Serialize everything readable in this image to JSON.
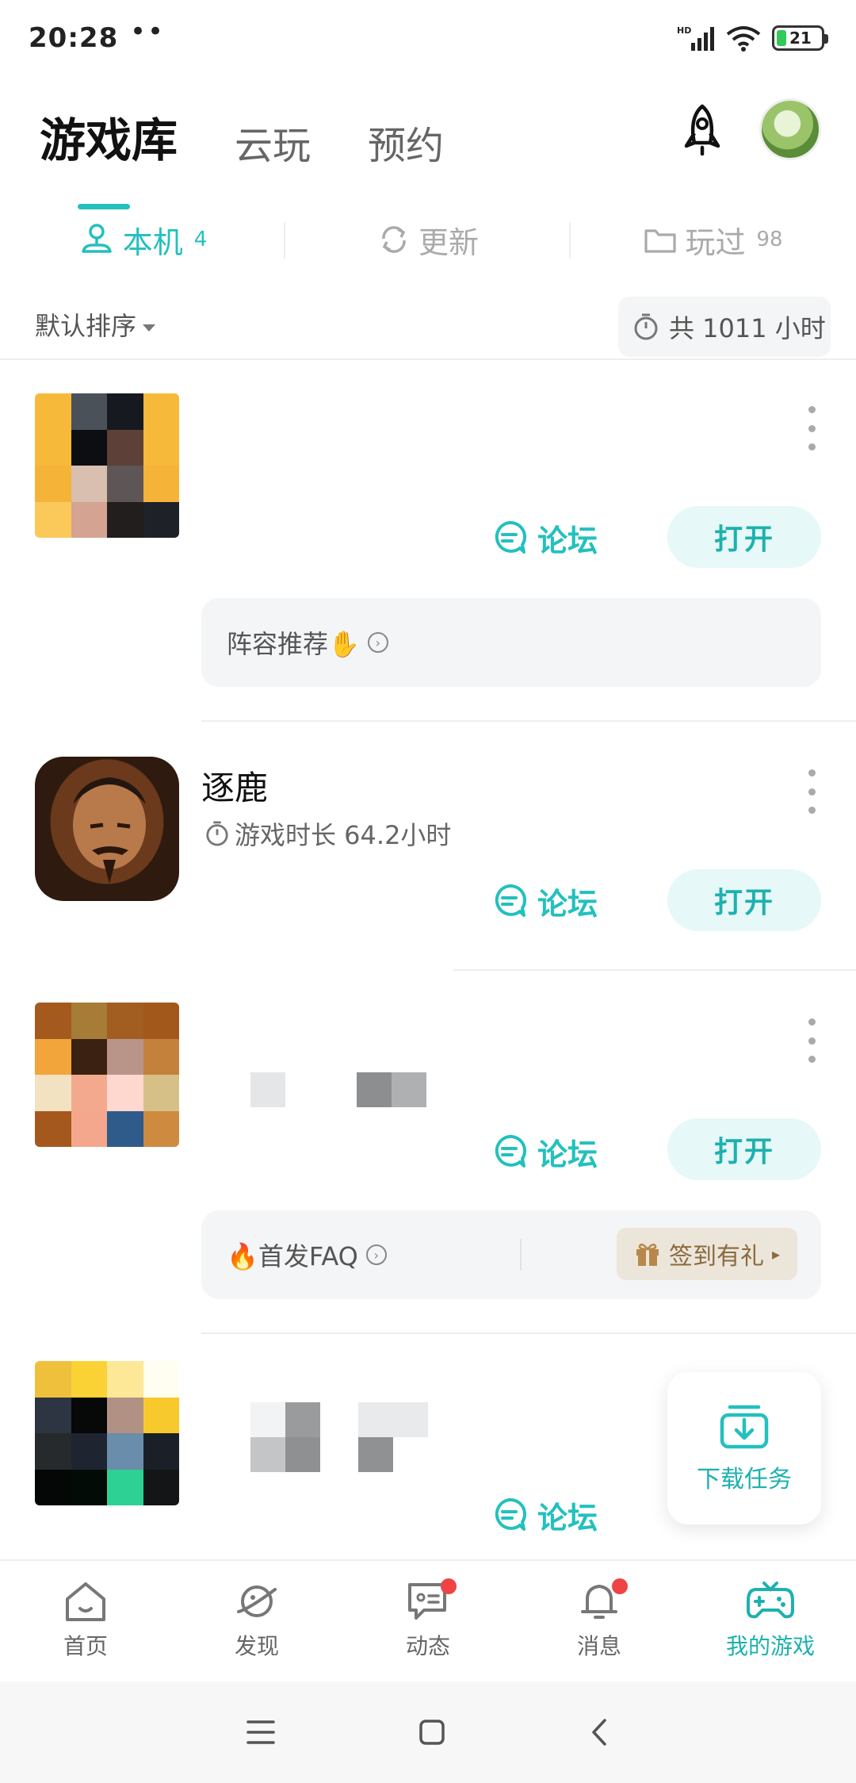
{
  "status_bar": {
    "time": "20:28",
    "dots": "••",
    "network": "HD",
    "battery": "21"
  },
  "top_tabs": [
    {
      "label": "游戏库",
      "active": true
    },
    {
      "label": "云玩",
      "active": false
    },
    {
      "label": "预约",
      "active": false
    }
  ],
  "sub_tabs": [
    {
      "label": "本机",
      "count": "4",
      "active": true,
      "icon": "person-device-icon"
    },
    {
      "label": "更新",
      "count": "",
      "active": false,
      "icon": "refresh-icon"
    },
    {
      "label": "玩过",
      "count": "98",
      "active": false,
      "icon": "folder-icon"
    }
  ],
  "sort": {
    "label": "默认排序"
  },
  "total_hours": "共 1011 小时",
  "games": [
    {
      "title": "",
      "forum_label": "论坛",
      "open_label": "打开",
      "info": "阵容推荐✋"
    },
    {
      "title": "逐鹿",
      "playtime": "游戏时长 64.2小时",
      "forum_label": "论坛",
      "open_label": "打开"
    },
    {
      "title": "",
      "forum_label": "论坛",
      "open_label": "打开",
      "info": "🔥首发FAQ",
      "gift_label": "签到有礼"
    },
    {
      "title": "",
      "forum_label": "论坛"
    }
  ],
  "download_float": {
    "label": "下载任务"
  },
  "bottom_nav": [
    {
      "label": "首页",
      "icon": "home-icon",
      "active": false,
      "badge": false
    },
    {
      "label": "发现",
      "icon": "planet-icon",
      "active": false,
      "badge": false
    },
    {
      "label": "动态",
      "icon": "message-square-icon",
      "active": false,
      "badge": true
    },
    {
      "label": "消息",
      "icon": "bell-icon",
      "active": false,
      "badge": true
    },
    {
      "label": "我的游戏",
      "icon": "gamepad-icon",
      "active": true,
      "badge": false
    }
  ],
  "colors": {
    "accent": "#23c0be",
    "badge": "#ee4444",
    "gift_bg": "#ece5da"
  }
}
